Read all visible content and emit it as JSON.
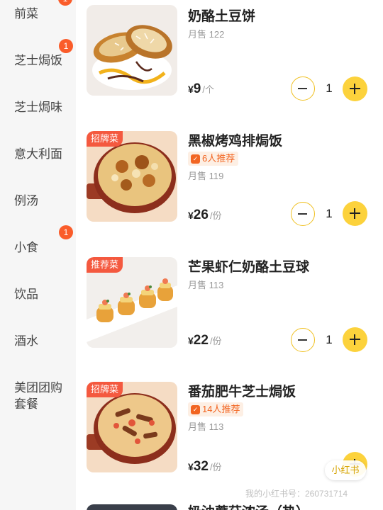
{
  "sidebar": {
    "items": [
      {
        "label": "前菜",
        "badge": ""
      },
      {
        "label": "芝士焗饭",
        "badge": "1"
      },
      {
        "label": "芝士焗味",
        "badge": ""
      },
      {
        "label": "意大利面",
        "badge": ""
      },
      {
        "label": "例汤",
        "badge": ""
      },
      {
        "label": "小食",
        "badge": "1"
      },
      {
        "label": "饮品",
        "badge": ""
      },
      {
        "label": "酒水",
        "badge": ""
      },
      {
        "label": "美团团购套餐",
        "badge": ""
      }
    ]
  },
  "dishes": [
    {
      "name": "奶酪土豆饼",
      "tag": "",
      "recommend": "",
      "sales": "月售 122",
      "currency": "¥",
      "price": "9",
      "unit": "/个",
      "quantity": "1"
    },
    {
      "name": "黑椒烤鸡排焗饭",
      "tag": "招牌菜",
      "recommend": "6人推荐",
      "sales": "月售 119",
      "currency": "¥",
      "price": "26",
      "unit": "/份",
      "quantity": "1"
    },
    {
      "name": "芒果虾仁奶酪土豆球",
      "tag": "推荐菜",
      "recommend": "",
      "sales": "月售 113",
      "currency": "¥",
      "price": "22",
      "unit": "/份",
      "quantity": "1"
    },
    {
      "name": "番茄肥牛芝士焗饭",
      "tag": "招牌菜",
      "recommend": "14人推荐",
      "sales": "月售 113",
      "currency": "¥",
      "price": "32",
      "unit": "/份",
      "quantity": ""
    }
  ],
  "partial_next_dish": "奶油蘑菇浓汤（热）",
  "floating_chip": "小红书",
  "watermark": "我的小红书号：260731714",
  "icons": {
    "recommend": "thumbs-up-icon",
    "minus": "minus-icon",
    "plus": "plus-icon"
  },
  "colors": {
    "accent": "#fcd23c",
    "badge": "#fa5c2a",
    "ribbon": "#f4593f",
    "recommend_text": "#f26522"
  }
}
